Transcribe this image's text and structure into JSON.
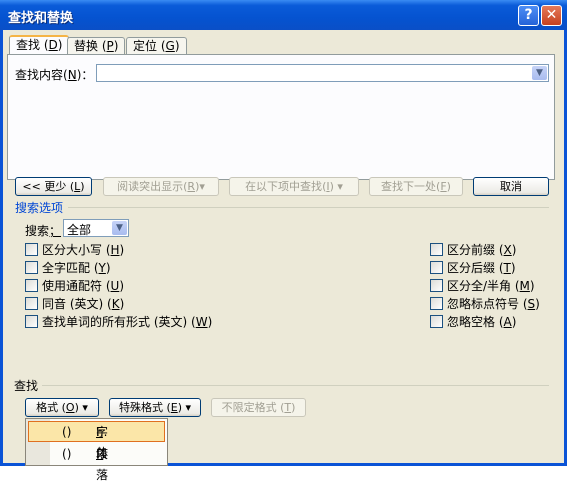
{
  "window": {
    "title": "查找和替换",
    "help_glyph": "?",
    "close_glyph": "✕"
  },
  "tabs": [
    {
      "label": "查找",
      "key": "D"
    },
    {
      "label": "替换",
      "key": "P"
    },
    {
      "label": "定位",
      "key": "G"
    }
  ],
  "find": {
    "label": "查找内容",
    "key": "N",
    "suffix": "：",
    "value": ""
  },
  "buttons": {
    "less": {
      "prefix": "<< ",
      "label": "更少",
      "key": "L"
    },
    "highlight": {
      "label": "阅读突出显示",
      "key": "R",
      "arrow": "▾"
    },
    "find_in": {
      "label": "在以下项中查找",
      "key": "I",
      "arrow": "▾"
    },
    "find_next": {
      "label": "查找下一处",
      "key": "F"
    },
    "cancel": "取消"
  },
  "search_options": {
    "title": "搜索选项",
    "search_label": "搜索",
    "search_key": "；",
    "search_value": "全部",
    "left": [
      {
        "label": "区分大小写",
        "key": "H"
      },
      {
        "label": "全字匹配",
        "key": "Y"
      },
      {
        "label": "使用通配符",
        "key": "U"
      },
      {
        "label": "同音 (英文)",
        "key": "K"
      },
      {
        "label": "查找单词的所有形式 (英文)",
        "key": "W"
      }
    ],
    "right": [
      {
        "label": "区分前缀",
        "key": "X"
      },
      {
        "label": "区分后缀",
        "key": "T"
      },
      {
        "label": "区分全/半角",
        "key": "M"
      },
      {
        "label": "忽略标点符号",
        "key": "S"
      },
      {
        "label": "忽略空格",
        "key": "A"
      }
    ]
  },
  "find_section": {
    "title": "查找",
    "format": {
      "label": "格式",
      "key": "O",
      "arrow": "▾"
    },
    "special": {
      "label": "特殊格式",
      "key": "E",
      "arrow": "▾"
    },
    "no_format": {
      "label": "不限定格式",
      "key": "T"
    }
  },
  "menu": [
    {
      "label": "字体",
      "key": "F",
      "suffix": "..."
    },
    {
      "label": "段落",
      "key": "P",
      "suffix": "..."
    }
  ],
  "colors": {
    "title_bar": "#0553d0",
    "section_title": "#0046d5",
    "menu_highlight": "#fbe6a8"
  }
}
